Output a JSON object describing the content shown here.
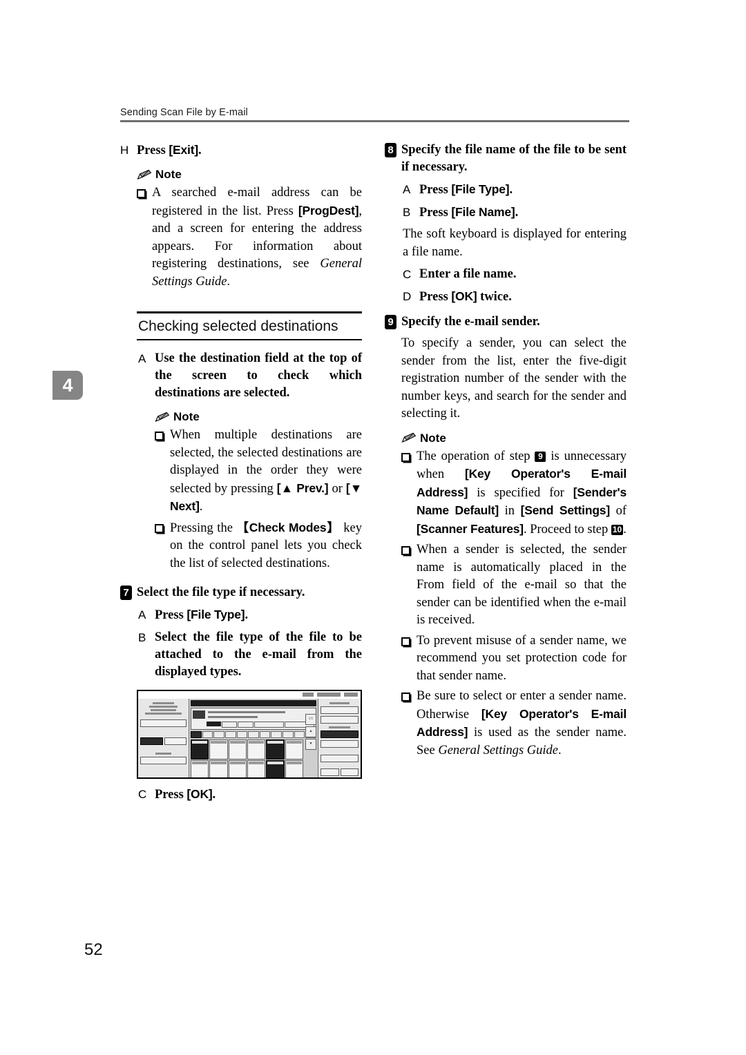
{
  "header": {
    "running_title": "Sending Scan File by E-mail"
  },
  "chapter_tab": {
    "number": "4"
  },
  "folio": {
    "page_number": "52"
  },
  "note_label": "Note",
  "left_column": {
    "step_H": {
      "marker": "H",
      "text_prefix": "Press ",
      "key": "[Exit]",
      "text_suffix": "."
    },
    "note_1": {
      "p1a": "A searched e-mail address can be registered in the list. Press ",
      "key1": "[ProgDest]",
      "p1b": ", and a screen for entering the address appears. For information about registering destinations, see ",
      "bookref": "General Settings Guide",
      "p1c": "."
    },
    "subsection": {
      "title": "Checking selected destinations"
    },
    "step_A": {
      "marker": "A",
      "text": "Use the destination field at the top of the screen to check which destinations are selected."
    },
    "note_2": {
      "item1a": "When multiple destinations are selected, the selected destinations are displayed in the order they were selected by pressing ",
      "item1key1": "[▲ Prev.]",
      "item1b": " or ",
      "item1key2": "[▼ Next]",
      "item1c": ".",
      "item2a": "Pressing the ",
      "item2key": "【Check Modes】",
      "item2b": " key on the control panel lets you check the list of selected destinations."
    },
    "step_7": {
      "badge": "7",
      "text": "Select the file type if necessary.",
      "sub_A": {
        "marker": "A",
        "prefix": "Press ",
        "key": "[File Type]",
        "suffix": "."
      },
      "sub_B": {
        "marker": "B",
        "text": "Select the file type of the file to be attached to the e-mail from the displayed types."
      },
      "sub_C": {
        "marker": "C",
        "prefix": "Press ",
        "key": "[OK]",
        "suffix": "."
      }
    },
    "figure": {
      "caption": "",
      "lcd": {
        "right_buttons": [
          "File Type",
          "Single Page",
          "TIFF / JPEG",
          "Multi-page",
          "TIFF",
          "PDF",
          "File Name",
          "Cancel",
          "OK"
        ],
        "paging": "1/1"
      }
    }
  },
  "right_column": {
    "step_8": {
      "badge": "8",
      "text": "Specify the file name of the file to be sent if necessary.",
      "sub_A": {
        "marker": "A",
        "prefix": "Press ",
        "key": "[File Type]",
        "suffix": "."
      },
      "sub_B": {
        "marker": "B",
        "prefix": "Press ",
        "key": "[File Name]",
        "suffix": "."
      },
      "sub_B_note": "The soft keyboard is displayed for entering a file name.",
      "sub_C": {
        "marker": "C",
        "text": "Enter a file name."
      },
      "sub_D": {
        "marker": "D",
        "prefix": "Press ",
        "key": "[OK]",
        "suffix": " twice."
      }
    },
    "step_9": {
      "badge": "9",
      "text": "Specify the e-mail sender.",
      "body": "To specify a sender, you can select the sender from the list, enter the five-digit registration number of the sender with the number keys, and search for the sender and selecting it."
    },
    "note_3": {
      "item1a": "The operation of step ",
      "item1badge": "9",
      "item1b": " is unnecessary when ",
      "item1key1": "[Key Operator's E-mail Address]",
      "item1c": " is specified for ",
      "item1key2": "[Sender's Name Default]",
      "item1d": " in ",
      "item1key3": "[Send Settings]",
      "item1e": " of ",
      "item1key4": "[Scanner Features]",
      "item1f": ". Proceed to step ",
      "item1badge2": "10",
      "item1g": ".",
      "item2": "When a sender is selected, the sender name is automatically placed in the From field of the e-mail so that the sender can be identified when the e-mail is received.",
      "item3": "To prevent misuse of a sender name, we recommend you set protection code for that sender name.",
      "item4a": "Be sure to select or enter a sender name. Otherwise ",
      "item4key": "[Key Operator's E-mail Address]",
      "item4b": " is used as the sender name. See ",
      "item4bookref": "General Settings Guide",
      "item4c": "."
    }
  }
}
